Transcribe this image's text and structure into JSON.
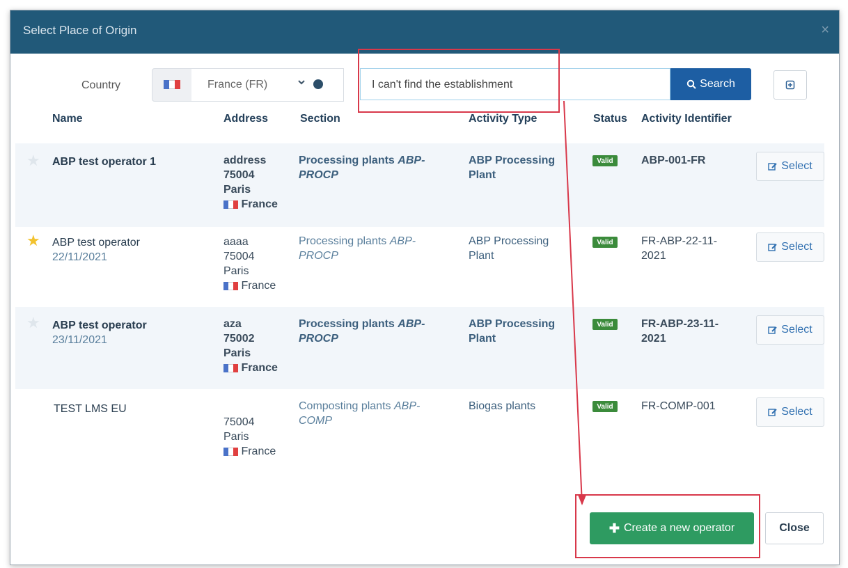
{
  "dialog": {
    "title": "Select Place of Origin",
    "close_glyph": "×"
  },
  "filters": {
    "country_label": "Country",
    "country_value": "France (FR)",
    "search_value": "I can't find the establishment",
    "search_button": "Search"
  },
  "table": {
    "headers": [
      "Name",
      "Address",
      "Section",
      "Activity Type",
      "Status",
      "Activity Identifier"
    ],
    "select_label": "Select",
    "rows": [
      {
        "name": "ABP test operator 1",
        "date": "",
        "address": [
          "address",
          "75004",
          "Paris"
        ],
        "country": "France",
        "section": "Processing plants",
        "section_code": "ABP-PROCP",
        "activity_type": "ABP Processing Plant",
        "status": "Valid",
        "identifier": "ABP-001-FR"
      },
      {
        "name": "ABP test operator",
        "date": "22/11/2021",
        "address": [
          "aaaa",
          "75004",
          "Paris"
        ],
        "country": "France",
        "section": "Processing plants",
        "section_code": "ABP-PROCP",
        "activity_type": "ABP Processing Plant",
        "status": "Valid",
        "identifier": "FR-ABP-22-11-2021"
      },
      {
        "name": "ABP test operator",
        "date": "23/11/2021",
        "address": [
          "aza",
          "75002",
          "Paris"
        ],
        "country": "France",
        "section": "Processing plants",
        "section_code": "ABP-PROCP",
        "activity_type": "ABP Processing Plant",
        "status": "Valid",
        "identifier": "FR-ABP-23-11-2021"
      },
      {
        "name": "TEST LMS EU",
        "date": "",
        "address": [
          "75004",
          "Paris"
        ],
        "country": "France",
        "section": "Composting plants",
        "section_code": "ABP-COMP",
        "activity_type": "Biogas plants",
        "status": "Valid",
        "identifier": "FR-COMP-001"
      }
    ]
  },
  "footer": {
    "create_label": "Create a new operator",
    "close_label": "Close"
  },
  "colors": {
    "titlebar": "#215979",
    "search_button": "#1d5ea3",
    "create_button": "#2e9b61",
    "valid_badge": "#3b8b3b",
    "highlight": "#d8384a"
  },
  "icons": [
    "france-flag-icon",
    "chevron-down-icon",
    "globe-icon",
    "search-icon",
    "expand-icon",
    "star-icon",
    "edit-icon",
    "plus-icon"
  ]
}
